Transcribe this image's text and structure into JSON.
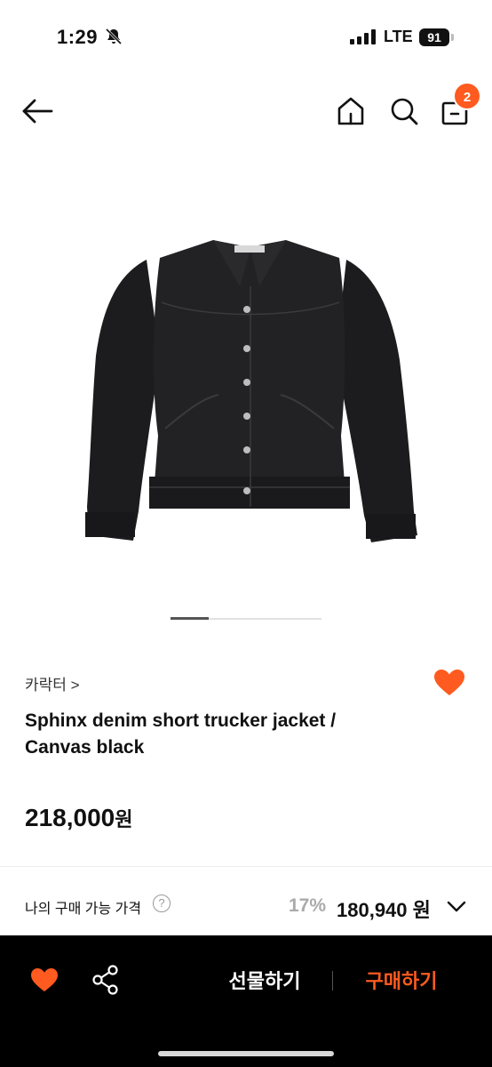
{
  "status_bar": {
    "time": "1:29",
    "network": "LTE",
    "battery": "91"
  },
  "nav": {
    "cart_count": "2",
    "icons": [
      "back-icon",
      "home-icon",
      "search-icon",
      "bag-icon"
    ]
  },
  "carousel": {
    "current": 1,
    "total": 4
  },
  "product": {
    "brand": "카락터 >",
    "title": "Sphinx denim short trucker jacket / Canvas black",
    "price": "218,000",
    "price_suffix": "원",
    "liked": true
  },
  "my_price": {
    "label": "나의 구매 가능 가격",
    "help": "?",
    "discount": "17%",
    "value": "180,940 원"
  },
  "bottom_bar": {
    "gift_label": "선물하기",
    "buy_label": "구매하기"
  },
  "colors": {
    "accent": "#ff5a1f",
    "bar_bg": "#000000"
  }
}
